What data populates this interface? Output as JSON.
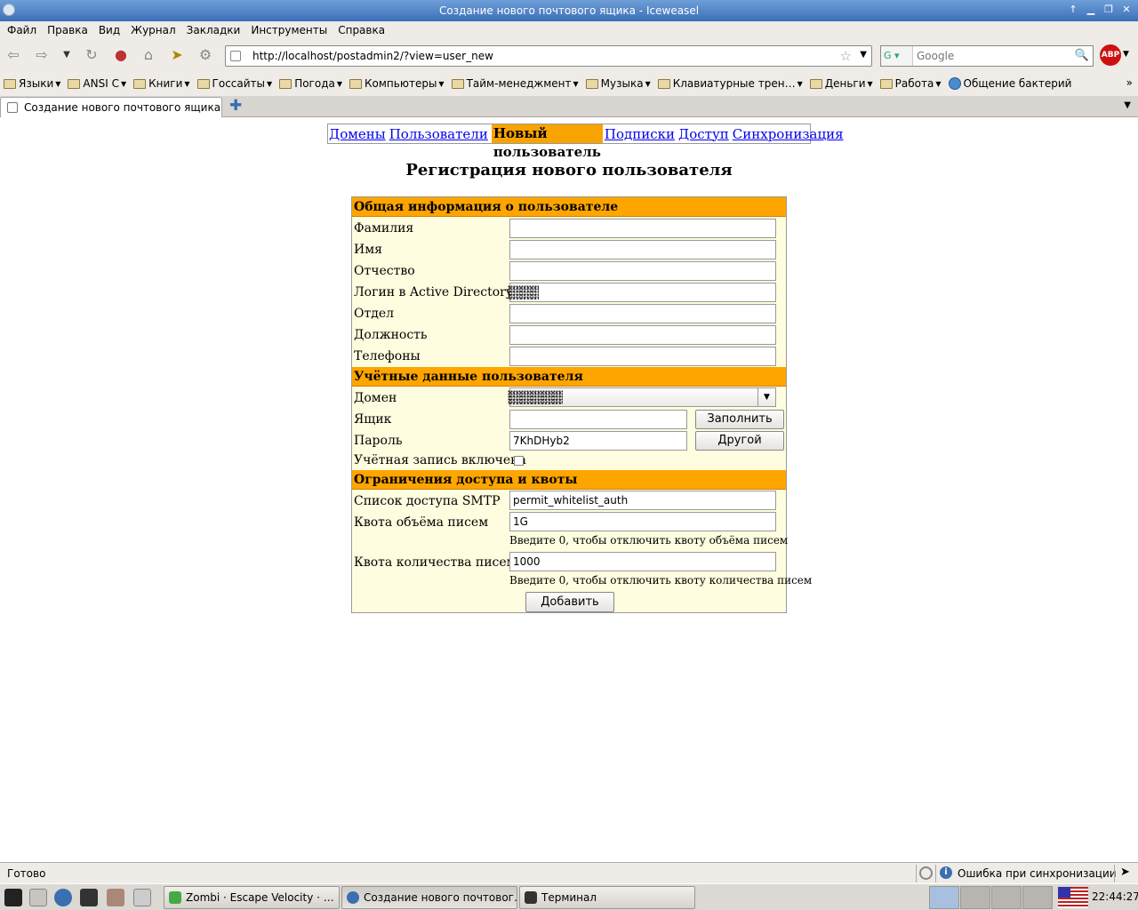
{
  "window": {
    "title": "Создание нового почтового ящика - Iceweasel"
  },
  "menu": [
    "Файл",
    "Правка",
    "Вид",
    "Журнал",
    "Закладки",
    "Инструменты",
    "Справка"
  ],
  "url": "http://localhost/postadmin2/?view=user_new",
  "search": {
    "placeholder": "Google"
  },
  "bookmarks": [
    {
      "label": "Языки",
      "type": "folder"
    },
    {
      "label": "ANSI C",
      "type": "folder"
    },
    {
      "label": "Книги",
      "type": "folder"
    },
    {
      "label": "Госсайты",
      "type": "folder"
    },
    {
      "label": "Погода",
      "type": "folder"
    },
    {
      "label": "Компьютеры",
      "type": "folder"
    },
    {
      "label": "Тайм-менеджмент",
      "type": "folder"
    },
    {
      "label": "Музыка",
      "type": "folder"
    },
    {
      "label": "Клавиатурные трен…",
      "type": "folder"
    },
    {
      "label": "Деньги",
      "type": "folder"
    },
    {
      "label": "Работа",
      "type": "folder"
    },
    {
      "label": "Общение бактерий",
      "type": "link"
    }
  ],
  "tab": {
    "label": "Создание нового почтового ящика"
  },
  "nav": {
    "domains": "Домены",
    "users": "Пользователи",
    "new_user": "Новый пользователь",
    "subscriptions": "Подписки",
    "access": "Доступ",
    "sync": "Синхронизация"
  },
  "page_title": "Регистрация нового пользователя",
  "form": {
    "section_general": "Общая информация о пользователе",
    "lastname": "Фамилия",
    "firstname": "Имя",
    "patronymic": "Отчество",
    "ad_login": "Логин в Active Directory",
    "department": "Отдел",
    "position": "Должность",
    "phones": "Телефоны",
    "section_account": "Учётные данные пользователя",
    "domain": "Домен",
    "mailbox": "Ящик",
    "fill_button": "Заполнить",
    "password": "Пароль",
    "password_value": "7KhDHyb2",
    "other_button": "Другой",
    "enabled": "Учётная запись включена",
    "section_limits": "Ограничения доступа и квоты",
    "smtp_list": "Список доступа SMTP",
    "smtp_list_value": "permit_whitelist_auth",
    "size_quota": "Квота объёма писем",
    "size_quota_value": "1G",
    "size_quota_hint": "Введите 0, чтобы отключить квоту объёма писем",
    "count_quota": "Квота количества писем",
    "count_quota_value": "1000",
    "count_quota_hint": "Введите 0, чтобы отключить квоту количества писем",
    "submit": "Добавить"
  },
  "status": {
    "text": "Готово",
    "sync_error": "Ошибка при синхронизации"
  },
  "taskbar": {
    "tasks": [
      "Zombi · Escape Velocity · …",
      "Создание нового почтовог…",
      "Терминал"
    ],
    "clock": "22:44:27"
  },
  "colors": {
    "section": "#ffa500",
    "form_bg": "#fffddf",
    "active_nav": "#f9a300"
  }
}
